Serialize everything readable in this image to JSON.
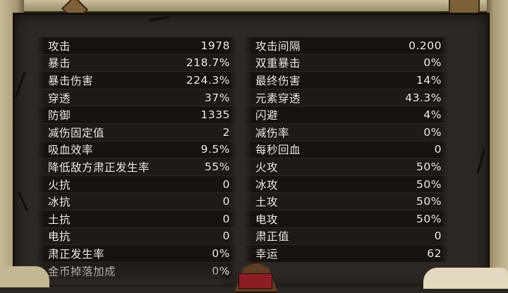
{
  "stats_left": [
    {
      "label": "攻击",
      "value": "1978"
    },
    {
      "label": "暴击",
      "value": "218.7%"
    },
    {
      "label": "暴击伤害",
      "value": "224.3%"
    },
    {
      "label": "穿透",
      "value": "37%"
    },
    {
      "label": "防御",
      "value": "1335"
    },
    {
      "label": "减伤固定值",
      "value": "2"
    },
    {
      "label": "吸血效率",
      "value": "9.5%"
    },
    {
      "label": "降低敌方肃正发生率",
      "value": "55%"
    },
    {
      "label": "火抗",
      "value": "0"
    },
    {
      "label": "冰抗",
      "value": "0"
    },
    {
      "label": "土抗",
      "value": "0"
    },
    {
      "label": "电抗",
      "value": "0"
    },
    {
      "label": "肃正发生率",
      "value": "0%"
    },
    {
      "label": "金币掉落加成",
      "value": "0%"
    }
  ],
  "stats_right": [
    {
      "label": "攻击间隔",
      "value": "0.200"
    },
    {
      "label": "双重暴击",
      "value": "0%"
    },
    {
      "label": "最终伤害",
      "value": "14%"
    },
    {
      "label": "元素穿透",
      "value": "43.3%"
    },
    {
      "label": "闪避",
      "value": "4%"
    },
    {
      "label": "减伤率",
      "value": "0%"
    },
    {
      "label": "每秒回血",
      "value": "0"
    },
    {
      "label": "火攻",
      "value": "50%"
    },
    {
      "label": "冰攻",
      "value": "50%"
    },
    {
      "label": "土攻",
      "value": "50%"
    },
    {
      "label": "电攻",
      "value": "50%"
    },
    {
      "label": "肃正值",
      "value": "0"
    },
    {
      "label": "幸运",
      "value": "62"
    }
  ],
  "colors": {
    "panel_bg": "#2e2824",
    "row_dark": "#161210",
    "text": "#f2efe9",
    "parchment": "#c9bb97"
  }
}
